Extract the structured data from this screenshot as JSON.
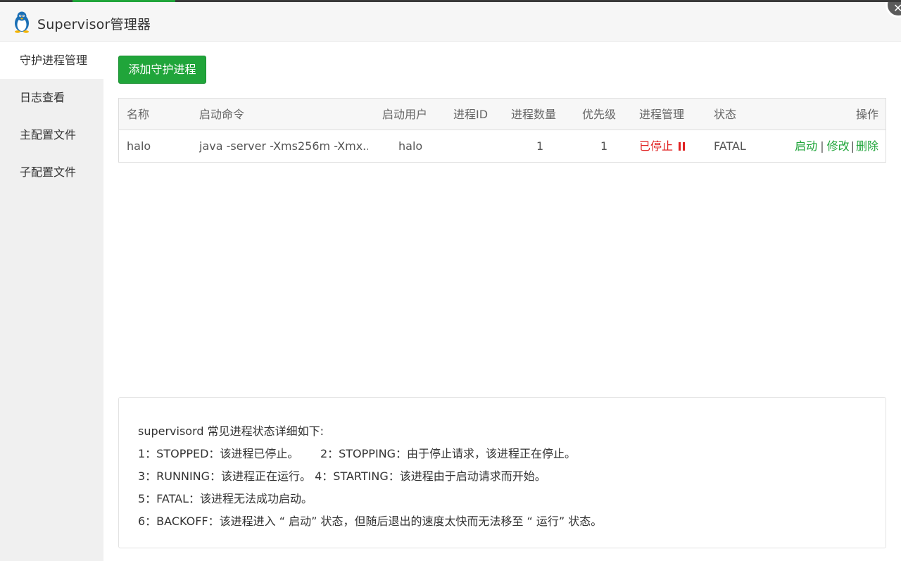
{
  "window": {
    "title": "Supervisor管理器",
    "logo_icon": "penguin-icon",
    "close_icon": "close-icon"
  },
  "sidebar": {
    "items": [
      {
        "label": "守护进程管理",
        "active": true
      },
      {
        "label": "日志查看",
        "active": false
      },
      {
        "label": "主配置文件",
        "active": false
      },
      {
        "label": "子配置文件",
        "active": false
      }
    ]
  },
  "toolbar": {
    "add_label": "添加守护进程"
  },
  "table": {
    "headers": [
      "名称",
      "启动命令",
      "启动用户",
      "进程ID",
      "进程数量",
      "优先级",
      "进程管理",
      "状态",
      "操作"
    ],
    "rows": [
      {
        "name": "halo",
        "command": "java -server -Xms256m -Xmx...",
        "user": "halo",
        "pid": "",
        "numprocs": "1",
        "priority": "1",
        "manage": "已停止",
        "status": "FATAL",
        "actions": {
          "start": "启动",
          "sep": "|",
          "edit": "修改",
          "delete": "删除"
        }
      }
    ]
  },
  "info": {
    "lines": [
      "supervisord 常见进程状态详细如下:",
      "1：STOPPED：该进程已停止。      2：STOPPING：由于停止请求，该进程正在停止。",
      "3：RUNNING：该进程正在运行。 4：STARTING：该进程由于启动请求而开始。",
      "5：FATAL：该进程无法成功启动。",
      "6：BACKOFF：该进程进入 “ 启动” 状态，但随后退出的速度太快而无法移至 “ 运行” 状态。"
    ]
  },
  "colors": {
    "accent": "#20a53a",
    "stopped": "#e02020"
  }
}
